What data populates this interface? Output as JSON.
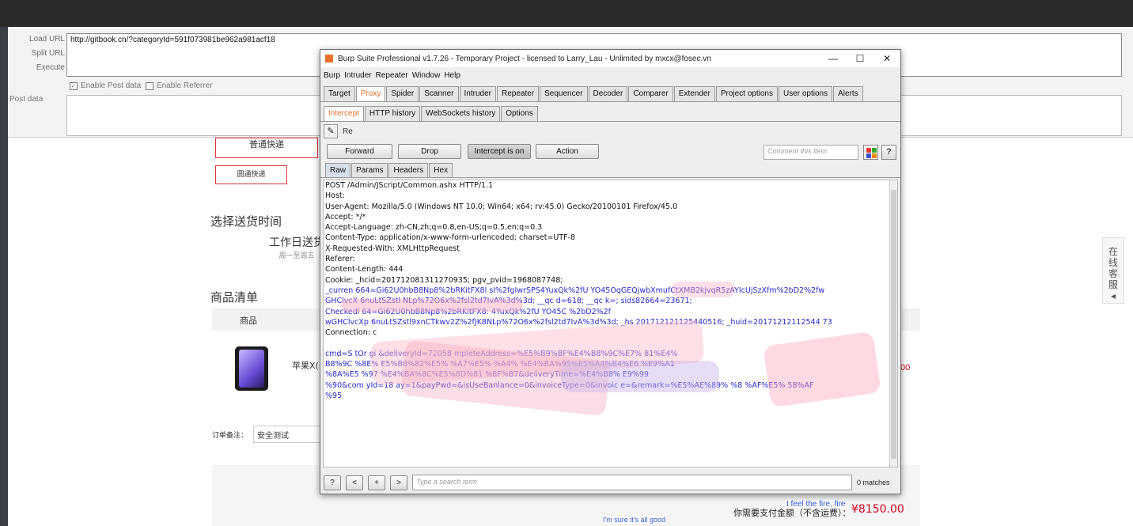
{
  "hackbar": {
    "load_url": "Load URL",
    "split_url": "Split URL",
    "execute": "Execute",
    "url_value": "http://gitbook.cn/?categoryId=591f073981be962a981acf18",
    "enable_post": "Enable Post data",
    "enable_referrer": "Enable Referrer",
    "post_data_label": "Post data"
  },
  "shop": {
    "shipping_normal": "普通快递",
    "shipping_yuantong": "圆通快递",
    "delivery_time_heading": "选择送货时间",
    "delivery_option": "工作日送货",
    "delivery_option_sub": "周一至周五",
    "product_list_heading": "商品清单",
    "product_col": "商品",
    "product_name": "苹果X(i",
    "price_fragment": "00",
    "remark_label": "订单备注：",
    "remark_value": "安全测试",
    "pay_label": "你需要支付金额（不含运费）：",
    "pay_total": "¥8150.00",
    "customer_service": [
      "在",
      "线",
      "客",
      "服",
      "◂"
    ],
    "caption_1": "I feel the fire, fire",
    "caption_2": "I'm sure it's all good"
  },
  "burp": {
    "title": "Burp Suite Professional v1.7.26 - Temporary Project - licensed to Larry_Lau - Unlimited by mxcx@fosec.vn",
    "window_buttons": {
      "minimize": "—",
      "maximize": "☐",
      "close": "✕"
    },
    "menu": [
      "Burp",
      "Intruder",
      "Repeater",
      "Window",
      "Help"
    ],
    "tabs": [
      "Target",
      "Proxy",
      "Spider",
      "Scanner",
      "Intruder",
      "Repeater",
      "Sequencer",
      "Decoder",
      "Comparer",
      "Extender",
      "Project options",
      "User options",
      "Alerts"
    ],
    "active_tab": "Proxy",
    "subtabs": [
      "Intercept",
      "HTTP history",
      "WebSockets history",
      "Options"
    ],
    "active_subtab": "Intercept",
    "request_info": "Re",
    "buttons": {
      "forward": "Forward",
      "drop": "Drop",
      "intercept": "Intercept is on",
      "action": "Action"
    },
    "comment_placeholder": "Comment this item",
    "help": "?",
    "view_tabs": [
      "Raw",
      "Params",
      "Headers",
      "Hex"
    ],
    "active_view_tab": "Raw",
    "request_lines": [
      {
        "text": "POST /Admin/JScript/Common.ashx HTTP/1.1",
        "color": "black"
      },
      {
        "text": "Host:",
        "color": "black"
      },
      {
        "text": "User-Agent: Mozilla/5.0 (Windows NT 10.0; Win64; x64; rv:45.0) Gecko/20100101 Firefox/45.0",
        "color": "black"
      },
      {
        "text": "Accept: */*",
        "color": "black"
      },
      {
        "text": "Accept-Language: zh-CN,zh;q=0.8,en-US;q=0.5,en;q=0.3",
        "color": "black"
      },
      {
        "text": "Content-Type: application/x-www-form-urlencoded; charset=UTF-8",
        "color": "black"
      },
      {
        "text": "X-Requested-With: XMLHttpRequest",
        "color": "black"
      },
      {
        "text": "Referer:",
        "color": "black"
      },
      {
        "text": "Content-Length: 444",
        "color": "black"
      },
      {
        "text": "Cookie: _hcid=201712081311270935; pgv_pvid=1968087748;",
        "color": "black"
      },
      {
        "text": "_curren    664=Gi62U0hbB8Np8%2bRKitFX8l     sI%2fgIwrSPS4YuxQk%2fU     YO45OqGEQjwbXmufCtXMB2kjvqR5zAYIcUjSzXfm%2bD2%2fw",
        "color": "blue"
      },
      {
        "text": "GHClvcX     6nuLtSZstl                    NLp%72O6x%2fsl2td7IvA%3d%3d; __qc   d=618;  __qc   k=;  sids82664=23671;",
        "color": "blue"
      },
      {
        "text": "Checkedl    64=Gi62U0hbB8Np8%2bRKitFX8:              4YuxQk%2fU       YO45C                                   %2bD2%2f",
        "color": "blue"
      },
      {
        "text": "wGHClvcXp    6nuLtSZstl9xnCTkwv2Z%2fJK8NLp%72O6x%2fsl2td7IvA%3d%3d; _hs    201712121125440516; _huid=20171212112544    73",
        "color": "blue"
      },
      {
        "text": "Connection: c",
        "color": "black"
      },
      {
        "text": "",
        "color": "black"
      },
      {
        "text": "cmd=S     tOr    gi                                     &deliveryId=72058     mpleteAddress=%E5%B9%BF%E4%B8%9C%E7%    81%E4%",
        "color": "blue"
      },
      {
        "text": "B8%9C    %8E%      E5%B8%82%E5%      %A7%E5%                  %A4%      %E4%BA%95%E5%A4%B4%E6           %E9%A1",
        "color": "blue"
      },
      {
        "text": "%8A%E5     %97                                     %E4%BA%8C%E5%8D%81        %8F%B7&deliveryTime=%E4%B8%    E9%99",
        "color": "blue"
      },
      {
        "text": "%90&com    yId=18      ay=1&payPwd=&isUseBanlance=0&invoiceType=0&invoic    e=&remark=%E5%AE%89%     %8   %AF%E5%  58%AF",
        "color": "blue"
      },
      {
        "text": "%95",
        "color": "blue"
      }
    ],
    "search": {
      "help": "?",
      "prev": "<",
      "add": "+",
      "next": ">",
      "placeholder": "Type a search term",
      "matches": "0 matches"
    }
  }
}
